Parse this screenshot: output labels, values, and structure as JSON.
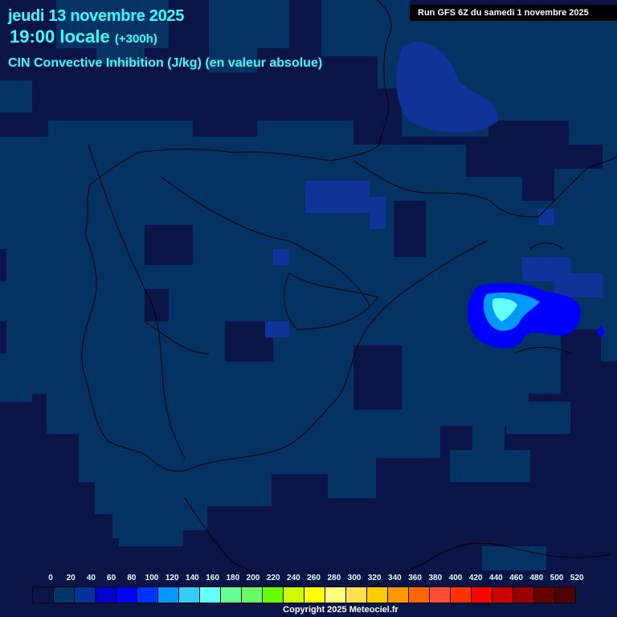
{
  "header": {
    "date": "jeudi 13 novembre 2025",
    "time": "19:00 locale",
    "lead": "(+300h)",
    "parameter": "CIN Convective Inhibition (J/kg) (en valeur absolue)",
    "run": "Run GFS 6Z du samedi 1 novembre 2025"
  },
  "legend": {
    "labels": [
      "0",
      "20",
      "40",
      "60",
      "80",
      "100",
      "120",
      "140",
      "160",
      "180",
      "200",
      "220",
      "240",
      "260",
      "280",
      "300",
      "320",
      "340",
      "360",
      "380",
      "400",
      "420",
      "440",
      "460",
      "480",
      "500",
      "520"
    ],
    "colors": [
      "#0a1446",
      "#003366",
      "#003399",
      "#0000cc",
      "#0000ff",
      "#0033ff",
      "#0099ff",
      "#33ccff",
      "#66ffff",
      "#66ff99",
      "#66ff66",
      "#66ff00",
      "#ccff00",
      "#ffff00",
      "#ffff80",
      "#ffe14d",
      "#ffcc00",
      "#ff9900",
      "#ff6600",
      "#ff4d33",
      "#ff3300",
      "#ff0000",
      "#cc0000",
      "#990000",
      "#660000",
      "#4d0000",
      "#000000"
    ]
  },
  "copyright": "Copyright 2025 Meteociel.fr"
}
